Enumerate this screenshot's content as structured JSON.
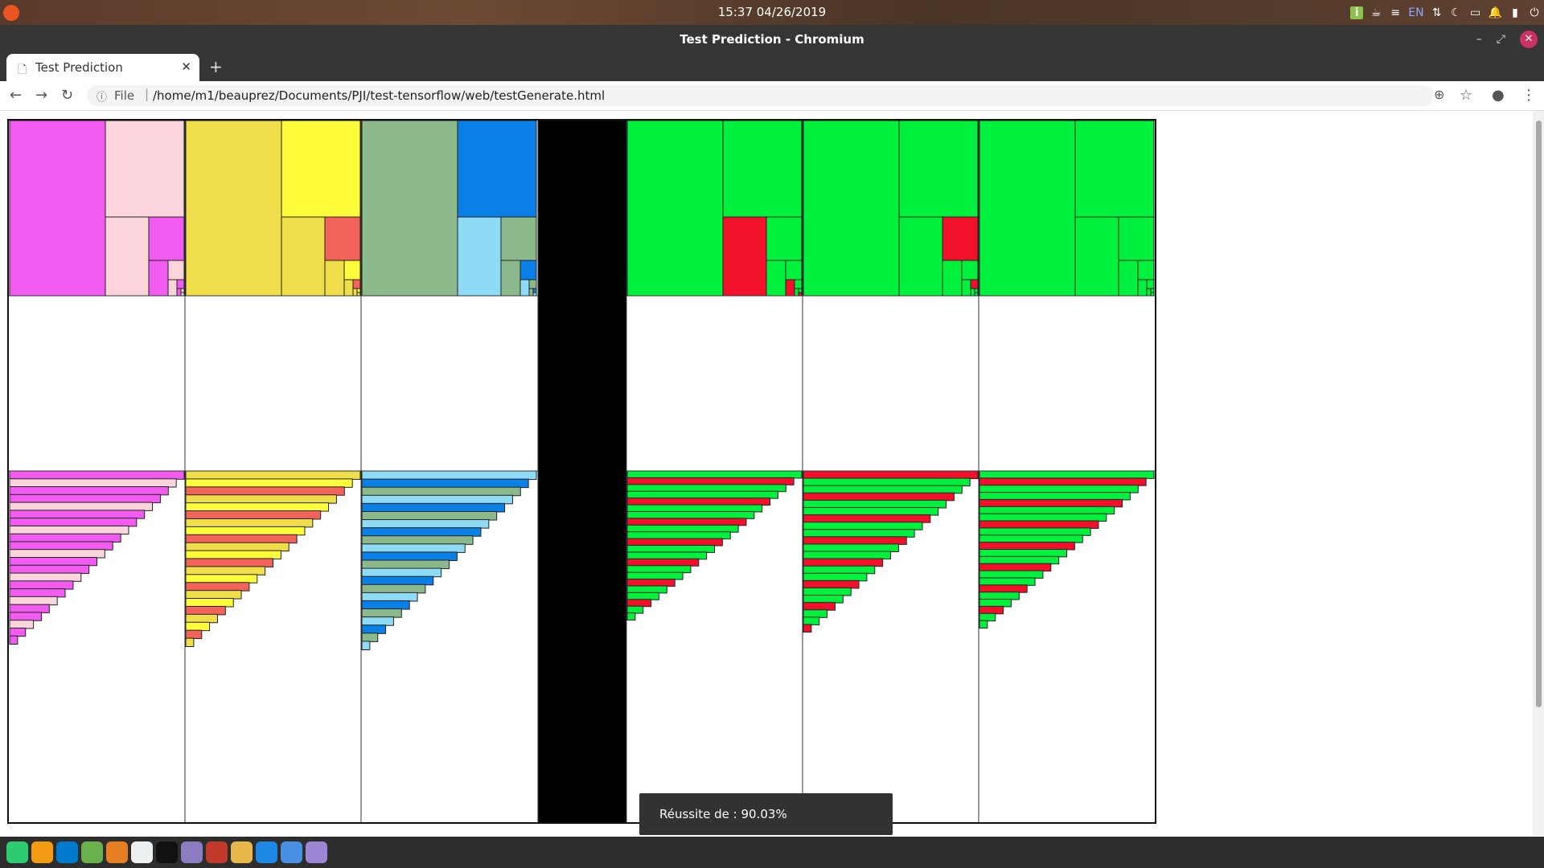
{
  "topbar": {
    "clock": "15:37 04/26/2019",
    "tray_language": "EN"
  },
  "window": {
    "title": "Test Prediction - Chromium"
  },
  "tabs": [
    {
      "label": "Test Prediction"
    }
  ],
  "toolbar": {
    "url_scheme_label": "File",
    "url": "/home/m1/beauprez/Documents/PJI/test-tensorflow/web/testGenerate.html"
  },
  "toast": {
    "text": "Réussite de : 90.03%"
  },
  "colors": {
    "magenta": "#f15bef",
    "pink": "#fcd5dc",
    "yellow": "#fffd3a",
    "gold": "#f0dd4a",
    "sage": "#8cb98c",
    "blue": "#0a7fe5",
    "lightblue": "#8edbf6",
    "green": "#00f13d",
    "red": "#f3102a",
    "salmon": "#f2645a",
    "black": "#000000"
  },
  "dock": {
    "icons": [
      "chromium-icon",
      "firefox-icon",
      "vscode-icon",
      "atom-icon",
      "media-player-icon",
      "calendar-icon",
      "terminal-icon",
      "files-icon",
      "image-viewer-icon",
      "java-icon",
      "text-editor-icon",
      "chromium-2-icon",
      "notes-icon"
    ]
  }
}
